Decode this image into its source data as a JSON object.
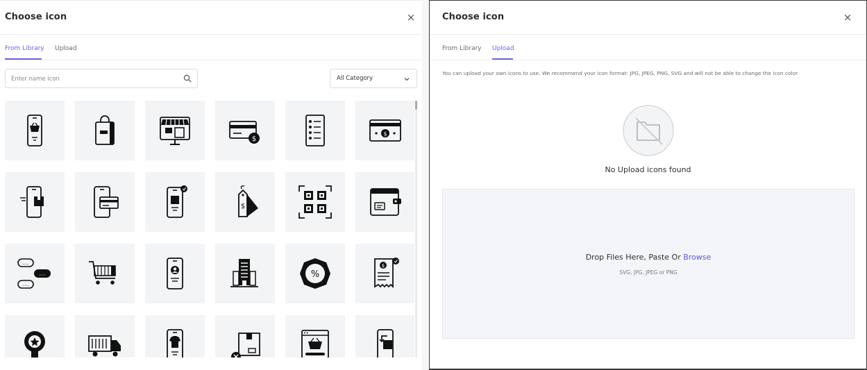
{
  "left_dialog": {
    "title": "Choose icon",
    "close_glyph": "×",
    "tabs": [
      {
        "label": "From Library",
        "active": true
      },
      {
        "label": "Upload",
        "active": false
      }
    ],
    "search": {
      "placeholder": "Enter name icon",
      "value": ""
    },
    "category": {
      "selected": "All Category"
    },
    "icons": [
      "mobile-shopping-basket-icon",
      "shopping-bag-icon",
      "online-store-monitor-icon",
      "credit-card-dollar-icon",
      "wishlist-document-icon",
      "dollar-card-icon",
      "mobile-package-delivery-icon",
      "mobile-card-payment-icon",
      "mobile-order-icon",
      "dollar-price-tag-icon",
      "qr-code-scan-icon",
      "wallet-icon",
      "chat-bubbles-icon",
      "shopping-cart-icon",
      "mobile-user-profile-icon",
      "office-building-icon",
      "discount-badge-icon",
      "receipt-dollar-icon",
      "award-badge-icon",
      "delivery-truck-icon",
      "mobile-tshirt-icon",
      "cancel-package-icon",
      "web-shop-basket-icon",
      "mobile-package-return-icon"
    ]
  },
  "right_dialog": {
    "title": "Choose icon",
    "close_glyph": "×",
    "tabs": [
      {
        "label": "From Library",
        "active": false
      },
      {
        "label": "Upload",
        "active": true
      }
    ],
    "info": "You can upload your own icons to use. We recommend your icon format: JPG, JPEG, PNG, SVG and will not be able to change the icon color",
    "empty_message": "No Upload icons found",
    "dropzone": {
      "prefix": "Drop Files Here, Paste Or ",
      "browse": "Browse",
      "formats": "SVG, JPG, JPEG or PNG"
    }
  },
  "colors": {
    "accent": "#6d63e6",
    "tile_bg": "#f3f4f6",
    "dropzone_bg": "#f3f5f9",
    "icon": "#111111"
  }
}
